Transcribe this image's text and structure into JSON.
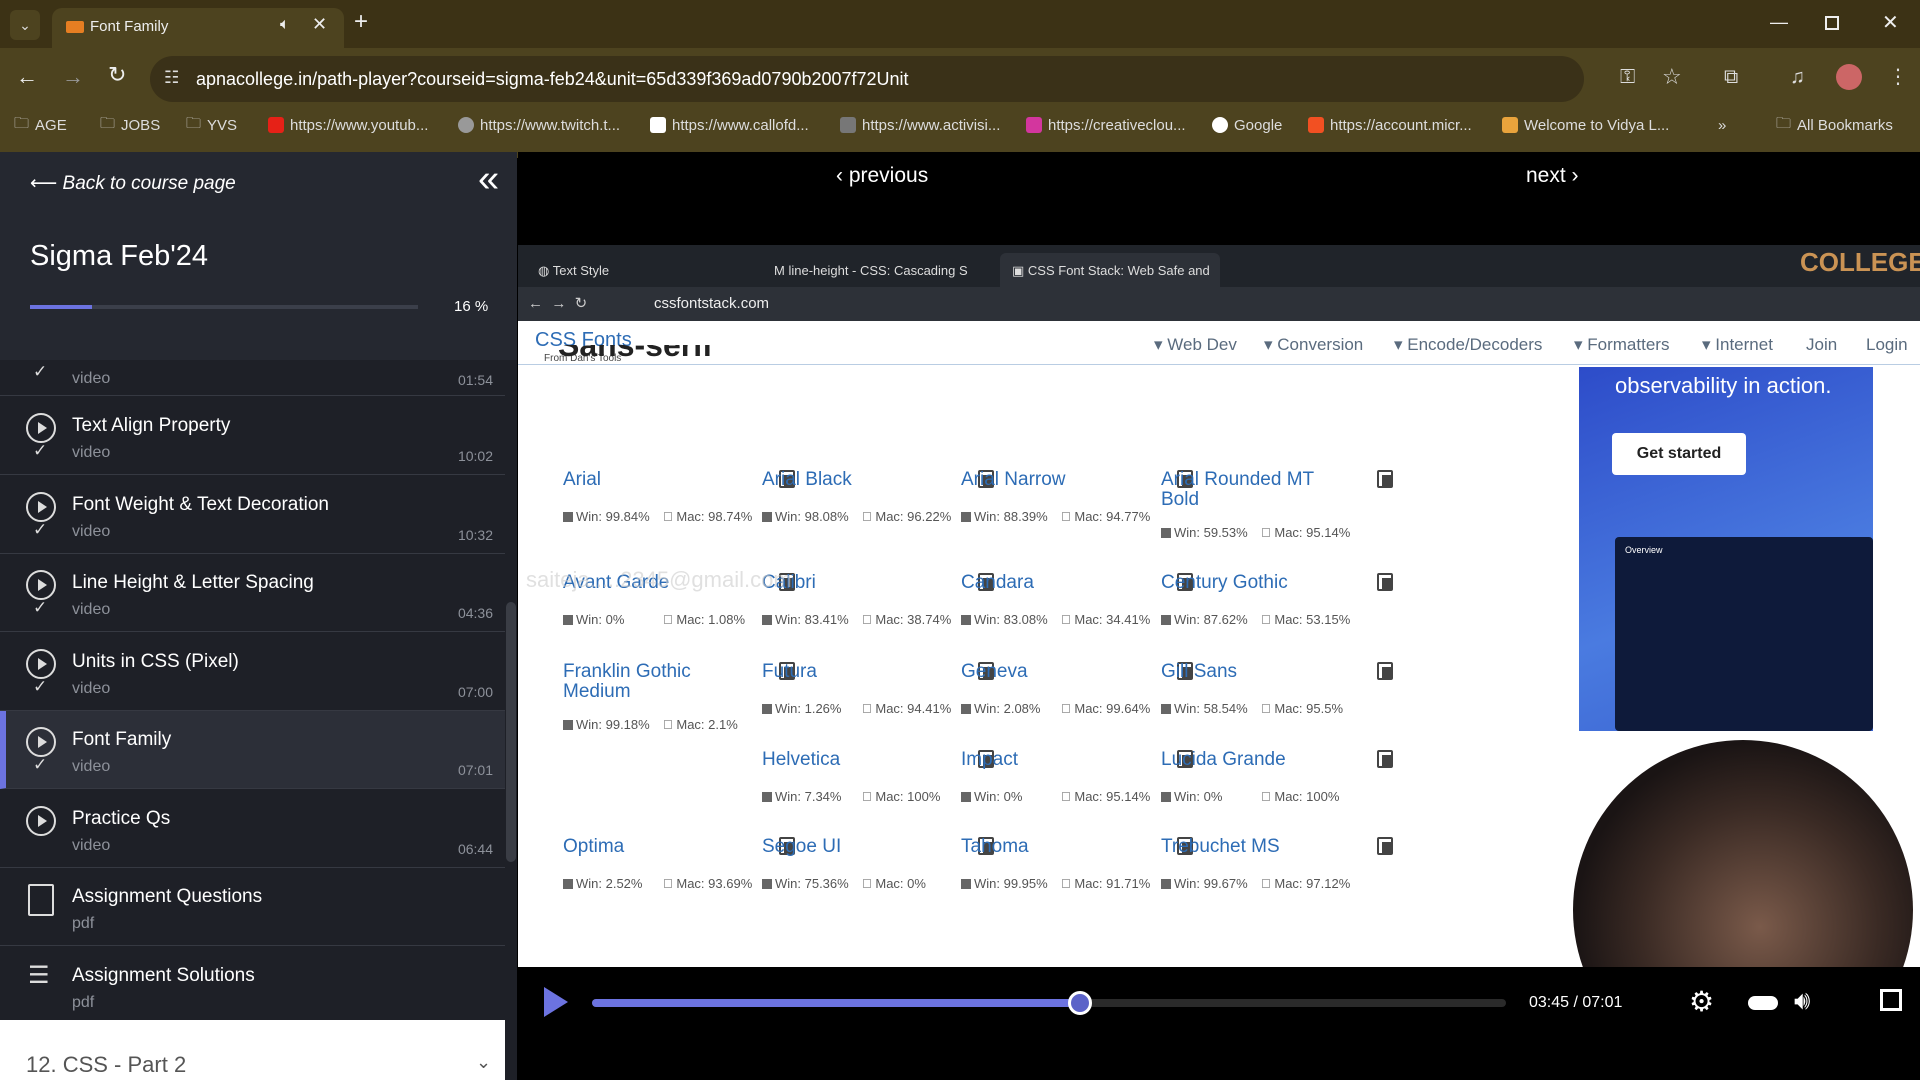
{
  "browser": {
    "tab_title": "Font Family",
    "url": "apnacollege.in/path-player?courseid=sigma-feb24&unit=65d339f369ad0790b2007f72Unit",
    "bookmarks": [
      "AGE",
      "JOBS",
      "YVS",
      "https://www.youtub...",
      "https://www.twitch.t...",
      "https://www.callofd...",
      "https://www.activisi...",
      "https://creativeclou...",
      "Google",
      "https://account.micr...",
      "Welcome to Vidya L..."
    ],
    "all_bookmarks": "All Bookmarks"
  },
  "sidebar": {
    "back": "Back to course page",
    "course": "Sigma Feb'24",
    "progress_text": "16 %",
    "progress": 0.16,
    "lessons": [
      {
        "title": "",
        "kind": "video",
        "duration": "01:54"
      },
      {
        "title": "Text Align Property",
        "kind": "video",
        "duration": "10:02"
      },
      {
        "title": "Font Weight & Text Decoration",
        "kind": "video",
        "duration": "10:32"
      },
      {
        "title": "Line Height & Letter Spacing",
        "kind": "video",
        "duration": "04:36"
      },
      {
        "title": "Units in CSS (Pixel)",
        "kind": "video",
        "duration": "07:00"
      },
      {
        "title": "Font Family",
        "kind": "video",
        "duration": "07:01"
      },
      {
        "title": "Practice Qs",
        "kind": "video",
        "duration": "06:44"
      },
      {
        "title": "Assignment Questions",
        "kind": "pdf",
        "duration": ""
      },
      {
        "title": "Assignment Solutions",
        "kind": "pdf",
        "duration": ""
      }
    ],
    "section": "12. CSS - Part 2"
  },
  "player": {
    "previous": "previous",
    "next": "next",
    "time": "03:45 / 07:01",
    "progress": 0.534
  },
  "inner": {
    "tabs": [
      "Text Style",
      "line-height - CSS: Cascading S",
      "CSS Font Stack: Web Safe and"
    ],
    "url": "cssfontstack.com",
    "logo": "CSS Fonts",
    "logo_sub": "From Dan's Tools",
    "nav": [
      "Web Dev",
      "Conversion",
      "Encode/Decoders",
      "Formatters",
      "Internet",
      "Join",
      "Login"
    ],
    "heading": "Sans-serif",
    "watermark": "APNA COLLEGE",
    "email": "saiteja.....2345@gmail.com",
    "ad_text": "observability in action.",
    "ad_button": "Get started",
    "ad_overview": "Overview",
    "fonts": [
      [
        "Arial",
        "Win: 99.84%",
        "Mac: 98.74%"
      ],
      [
        "Arial Black",
        "Win: 98.08%",
        "Mac: 96.22%"
      ],
      [
        "Arial Narrow",
        "Win: 88.39%",
        "Mac: 94.77%"
      ],
      [
        "Arial Rounded MT Bold",
        "Win: 59.53%",
        "Mac: 95.14%"
      ],
      [
        "Avant Garde",
        "Win: 0%",
        "Mac: 1.08%"
      ],
      [
        "Calibri",
        "Win: 83.41%",
        "Mac: 38.74%"
      ],
      [
        "Candara",
        "Win: 83.08%",
        "Mac: 34.41%"
      ],
      [
        "Century Gothic",
        "Win: 87.62%",
        "Mac: 53.15%"
      ],
      [
        "Franklin Gothic Medium",
        "Win: 99.18%",
        "Mac: 2.1%"
      ],
      [
        "Futura",
        "Win: 1.26%",
        "Mac: 94.41%"
      ],
      [
        "Geneva",
        "Win: 2.08%",
        "Mac: 99.64%"
      ],
      [
        "Gill Sans",
        "Win: 58.54%",
        "Mac: 95.5%"
      ],
      [
        "Helvetica",
        "Win: 7.34%",
        "Mac: 100%"
      ],
      [
        "Impact",
        "Win: 0%",
        "Mac: 95.14%"
      ],
      [
        "Lucida Grande",
        "Win: 0%",
        "Mac: 100%"
      ],
      [
        "Optima",
        "Win: 2.52%",
        "Mac: 93.69%"
      ],
      [
        "Segoe UI",
        "Win: 75.36%",
        "Mac: 0%"
      ],
      [
        "Tahoma",
        "Win: 99.95%",
        "Mac: 91.71%"
      ],
      [
        "Trebuchet MS",
        "Win: 99.67%",
        "Mac: 97.12%"
      ]
    ]
  }
}
